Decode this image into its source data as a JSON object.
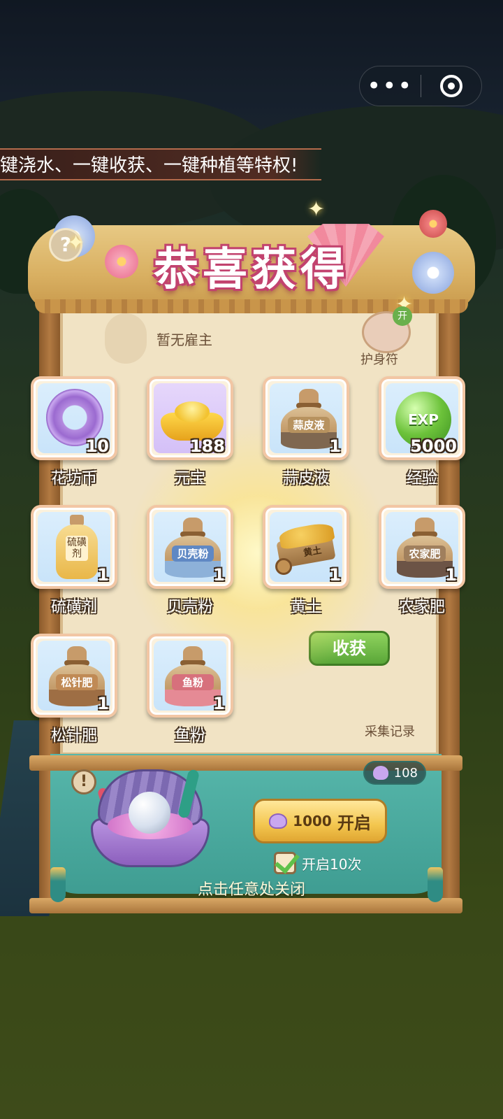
{
  "marquee": {
    "text": "键浇水、一键收获、一键种植等特权!"
  },
  "capsule": {
    "more_icon": "more-dots-icon",
    "close_icon": "target-close-icon"
  },
  "title": {
    "text": "恭喜获得"
  },
  "board": {
    "employer_text": "暂无雇主",
    "amulet_label": "护身符",
    "amulet_badge": "开",
    "collect_button": "收获",
    "record_label": "采集记录",
    "hint_icon": "?"
  },
  "rewards": [
    {
      "name": "花坊币",
      "qty": "10",
      "icon": "flower-coin-icon"
    },
    {
      "name": "元宝",
      "qty": "188",
      "icon": "gold-ingot-icon"
    },
    {
      "name": "蒜皮液",
      "qty": "1",
      "icon": "bag-icon",
      "label": "蒜皮液"
    },
    {
      "name": "经验",
      "qty": "5000",
      "icon": "exp-orb-icon",
      "label": "EXP"
    },
    {
      "name": "硫磺剂",
      "qty": "1",
      "icon": "bottle-icon",
      "label": "硫磺剂"
    },
    {
      "name": "贝壳粉",
      "qty": "1",
      "icon": "bag-icon",
      "label": "贝壳粉"
    },
    {
      "name": "黄土",
      "qty": "1",
      "icon": "cart-icon",
      "label": "黄土"
    },
    {
      "name": "农家肥",
      "qty": "1",
      "icon": "bag-icon",
      "label": "农家肥"
    },
    {
      "name": "松针肥",
      "qty": "1",
      "icon": "bag-icon",
      "label": "松针肥"
    },
    {
      "name": "鱼粉",
      "qty": "1",
      "icon": "bag-icon",
      "label": "鱼粉"
    }
  ],
  "shell_panel": {
    "pearl_count": "108",
    "open_cost": "1000",
    "open_label": "开启",
    "ten_label": "开启10次",
    "warn_icon": "!"
  },
  "close_hint": "点击任意处关闭",
  "colors": {
    "title_outline": "#c2426e",
    "panel": "#4aa99e",
    "button_gold": "#f3c64e"
  }
}
